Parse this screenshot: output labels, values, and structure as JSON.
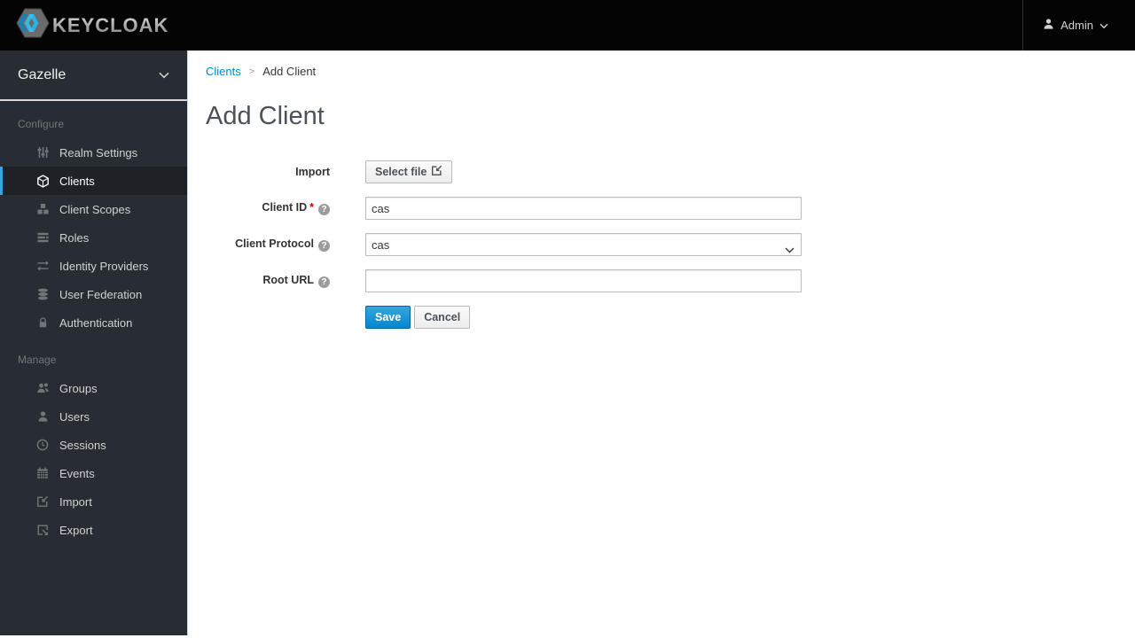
{
  "topbar": {
    "brand": "KEYCLOAK",
    "user_label": "Admin"
  },
  "sidebar": {
    "realm": "Gazelle",
    "sections": [
      {
        "label": "Configure",
        "items": [
          {
            "label": "Realm Settings",
            "icon": "sliders-icon",
            "active": false
          },
          {
            "label": "Clients",
            "icon": "cube-icon",
            "active": true
          },
          {
            "label": "Client Scopes",
            "icon": "cubes-icon",
            "active": false
          },
          {
            "label": "Roles",
            "icon": "list-icon",
            "active": false
          },
          {
            "label": "Identity Providers",
            "icon": "exchange-icon",
            "active": false
          },
          {
            "label": "User Federation",
            "icon": "database-icon",
            "active": false
          },
          {
            "label": "Authentication",
            "icon": "lock-icon",
            "active": false
          }
        ]
      },
      {
        "label": "Manage",
        "items": [
          {
            "label": "Groups",
            "icon": "groups-icon",
            "active": false
          },
          {
            "label": "Users",
            "icon": "user-icon",
            "active": false
          },
          {
            "label": "Sessions",
            "icon": "clock-icon",
            "active": false
          },
          {
            "label": "Events",
            "icon": "calendar-icon",
            "active": false
          },
          {
            "label": "Import",
            "icon": "import-icon",
            "active": false
          },
          {
            "label": "Export",
            "icon": "export-icon",
            "active": false
          }
        ]
      }
    ]
  },
  "breadcrumb": {
    "items": [
      "Clients",
      "Add Client"
    ],
    "separator": ">"
  },
  "page": {
    "title": "Add Client"
  },
  "form": {
    "required_marker": "*",
    "help_char": "?",
    "fields": [
      {
        "label": "Import",
        "type": "file-button",
        "button_label": "Select file"
      },
      {
        "label": "Client ID",
        "type": "text",
        "value": "cas",
        "required": true,
        "help": true
      },
      {
        "label": "Client Protocol",
        "type": "select",
        "value": "cas",
        "help": true
      },
      {
        "label": "Root URL",
        "type": "text",
        "value": "",
        "help": true
      }
    ],
    "save_label": "Save",
    "cancel_label": "Cancel"
  },
  "colors": {
    "topbar_bg": "#040404",
    "sidebar_bg": "#282d33",
    "active_item_border": "#39a5dc",
    "link_blue": "#0088ce",
    "primary_button": "#0088ce",
    "required_red": "#c00"
  }
}
